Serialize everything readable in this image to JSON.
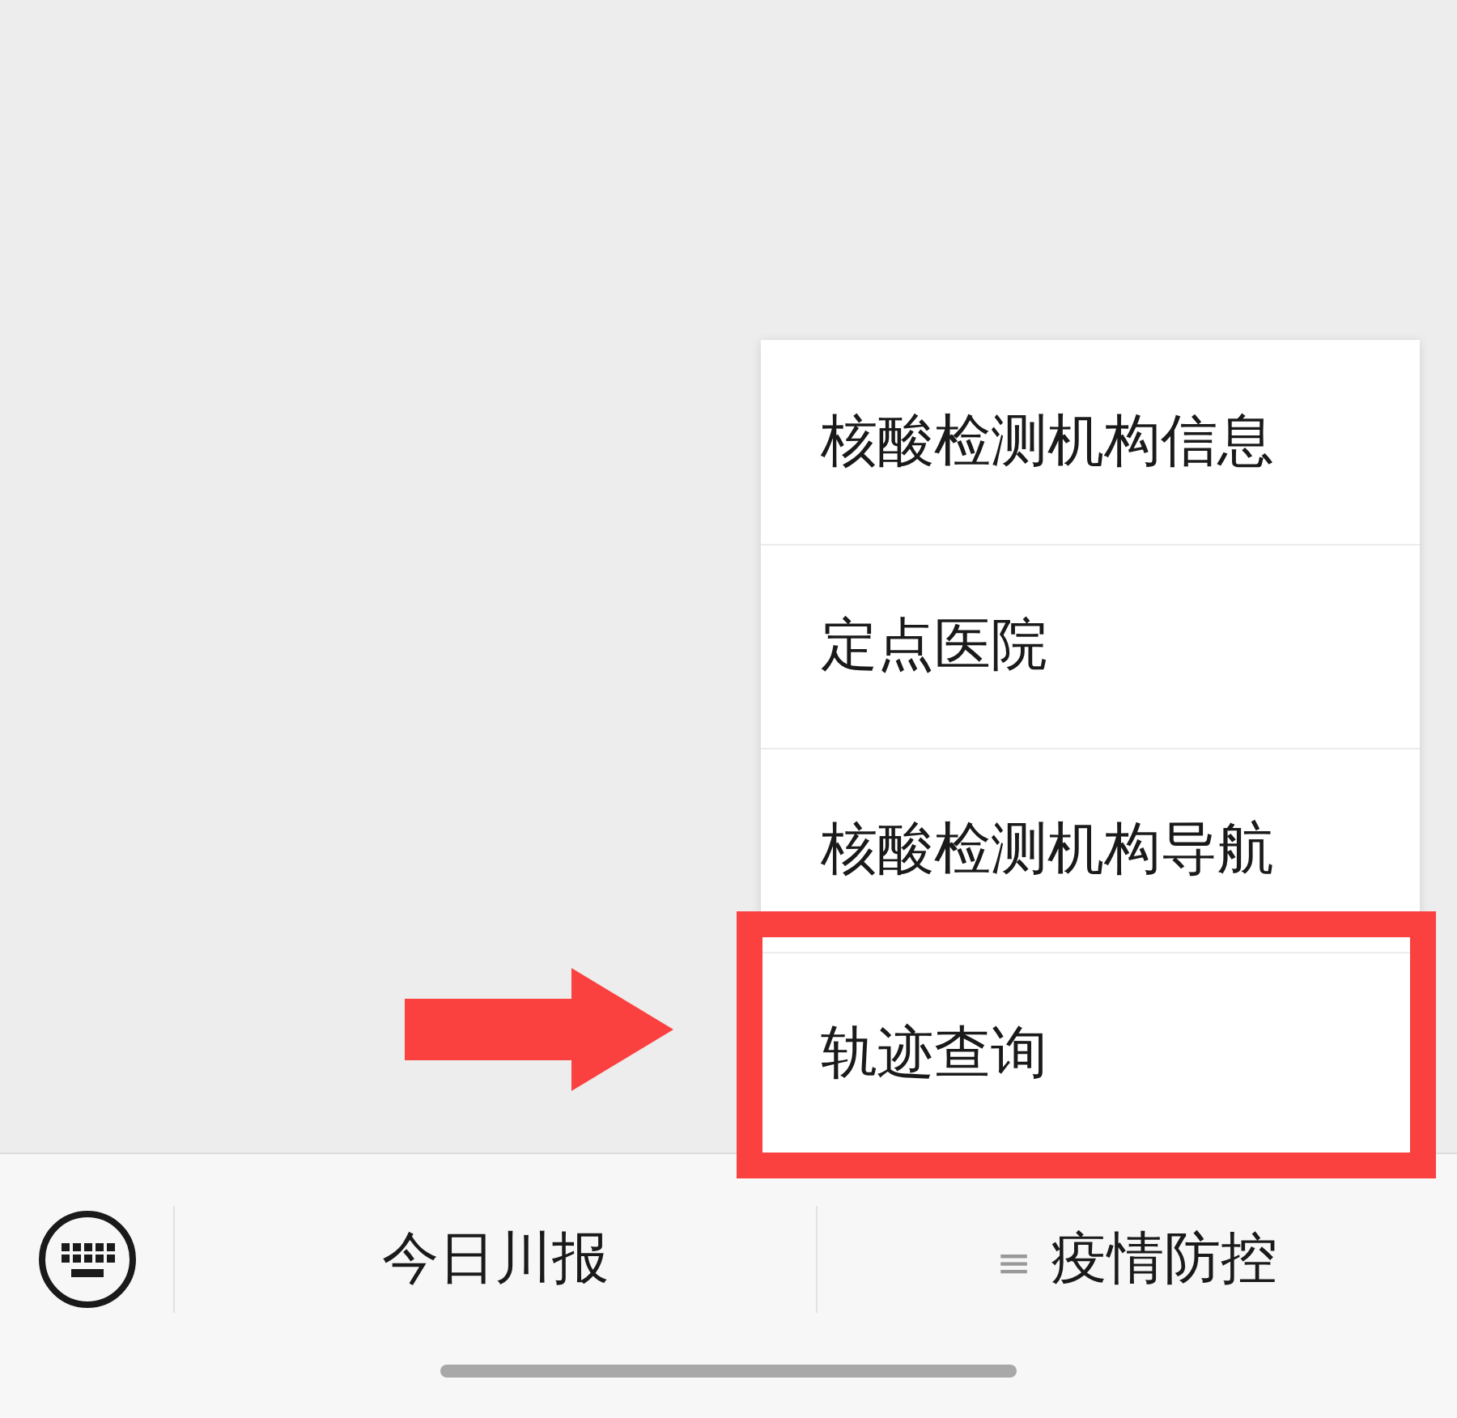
{
  "menu": {
    "items": [
      {
        "label": "核酸检测机构信息",
        "highlighted": false
      },
      {
        "label": "定点医院",
        "highlighted": false
      },
      {
        "label": "核酸检测机构导航",
        "highlighted": false
      },
      {
        "label": "轨迹查询",
        "highlighted": true
      }
    ]
  },
  "bottom_bar": {
    "tabs": [
      {
        "label": "今日川报",
        "kind": "plain"
      },
      {
        "label": "疫情防控",
        "kind": "menu",
        "mark": "≡"
      }
    ]
  }
}
